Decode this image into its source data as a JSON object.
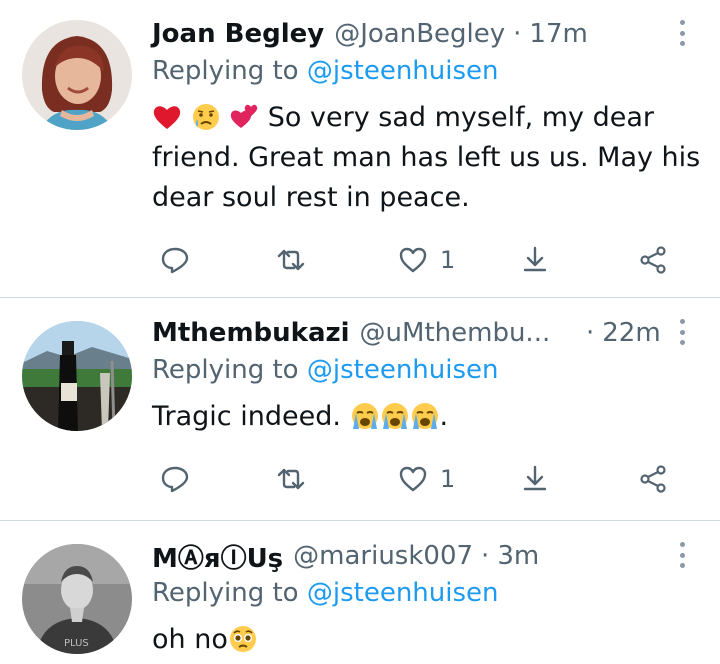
{
  "tweets": [
    {
      "name": "Joan Begley",
      "handle": "@JoanBegley",
      "separator": "·",
      "time": "17m",
      "replying_prefix": "Replying to",
      "replying_to": "@jsteenhuisen",
      "text": "So very sad myself, my dear friend. Great man has left us us. May his dear soul rest in peace.",
      "emojis": [
        "red-heart-emoji",
        "sad-relieved-face-emoji",
        "two-hearts-emoji"
      ],
      "like_count": "1"
    },
    {
      "name": "Mthembukazi",
      "handle": "@uMthembu...",
      "separator": "·",
      "time": "22m",
      "replying_prefix": "Replying to",
      "replying_to": "@jsteenhuisen",
      "text": "Tragic indeed.",
      "text_suffix": ".",
      "emojis": [
        "loudly-crying-face-emoji",
        "loudly-crying-face-emoji",
        "loudly-crying-face-emoji"
      ],
      "like_count": "1"
    },
    {
      "name": "MⒶяⒾUş",
      "handle": "@mariusk007",
      "separator": "·",
      "time": "3m",
      "replying_prefix": "Replying to",
      "replying_to": "@jsteenhuisen",
      "text": "oh no",
      "emojis": [
        "pleading-face-emoji"
      ]
    }
  ],
  "icons": {
    "reply": "reply-icon",
    "retweet": "retweet-icon",
    "like": "heart-icon",
    "bookmark": "download-icon",
    "share": "share-icon",
    "more": "more-vertical-icon"
  },
  "colors": {
    "link": "#1d9bf0",
    "secondary_text": "#536471",
    "divider": "#cfd9de"
  }
}
